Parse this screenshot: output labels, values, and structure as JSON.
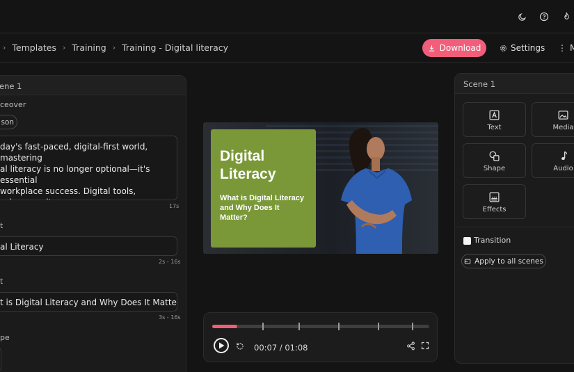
{
  "breadcrumb": {
    "items": [
      "Templates",
      "Training",
      "Training - Digital literacy"
    ]
  },
  "toolbar": {
    "download_label": "Download",
    "settings_label": "Settings",
    "more_label": "M"
  },
  "left_panel": {
    "scene_title": "ene 1",
    "voiceover_label": "ceover",
    "voice_chip": "son",
    "script_text": "day's fast-paced, digital-first world, mastering\nal literacy is no longer optional—it's essential\nworkplace success. Digital tools, cybersecurity\neness, and data proficiency are the building\nts for a thriving career.",
    "script_duration": "17s",
    "text1_label": "t",
    "text1_value": "al Literacy",
    "text1_range": "2s - 16s",
    "text2_label": "t",
    "text2_value": "t is Digital Literacy and Why Does It Matter?",
    "text2_range": "3s - 16s",
    "shape_label": "pe"
  },
  "video": {
    "title": "Digital\nLiteracy",
    "subtitle": "What is Digital Literacy and Why Does It Matter?"
  },
  "player": {
    "current_time": "00:07",
    "total_time": "01:08",
    "separator": " / ",
    "progress": 0.115
  },
  "right_panel": {
    "scene_title": "Scene 1",
    "tools": [
      {
        "label": "Text",
        "icon": "text-icon"
      },
      {
        "label": "Media",
        "icon": "image-icon"
      },
      {
        "label": "Shape",
        "icon": "shape-icon"
      },
      {
        "label": "Audio",
        "icon": "music-note-icon"
      },
      {
        "label": "Effects",
        "icon": "effects-icon"
      }
    ],
    "transition_label": "Transition",
    "apply_label": "Apply to all scenes"
  },
  "colors": {
    "accent": "#f25d7a",
    "card_green": "#7a9838",
    "background": "#141414"
  }
}
